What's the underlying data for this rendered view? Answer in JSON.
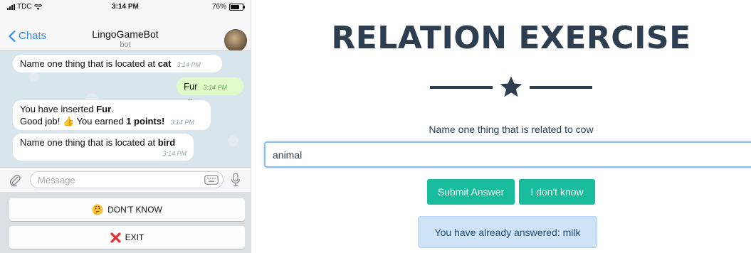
{
  "phone": {
    "status_bar": {
      "carrier": "TDC",
      "time": "3:14 PM",
      "battery_text": "76%",
      "battery_level": 0.76
    },
    "nav": {
      "back_label": "Chats",
      "title": "LingoGameBot",
      "subtitle": "bot"
    },
    "messages": [
      {
        "direction": "in",
        "text": "Name one thing that is located at ",
        "bold": "cat",
        "time": "3:14 PM"
      },
      {
        "direction": "out",
        "text": "Fur",
        "time": "3:14 PM"
      },
      {
        "direction": "in",
        "line1_text": "You have inserted ",
        "line1_bold": "Fur",
        "line1_end": ".",
        "line2_text": "Good job! ",
        "line2_mid": " You earned ",
        "line2_bold": "1 points!",
        "time": "3:14 PM"
      },
      {
        "direction": "in",
        "text": "Name one thing that is located at ",
        "bold": "bird",
        "time": "3:14 PM"
      }
    ],
    "input": {
      "placeholder": "Message"
    },
    "keyboard_buttons": [
      {
        "label": "DON'T KNOW",
        "icon": "thinking-face-icon"
      },
      {
        "label": "EXIT",
        "icon": "red-x-icon"
      }
    ]
  },
  "web": {
    "title": "RELATION EXERCISE",
    "question": "Name one thing that is related to cow",
    "answer_value": "animal",
    "buttons": {
      "submit": "Submit Answer",
      "dont_know": "I don't know"
    },
    "alert": "You have already answered: milk"
  },
  "colors": {
    "telegram_blue": "#2f8ef4",
    "chat_wallpaper": "#d9e5ec",
    "outgoing_bubble": "#e0fbc8",
    "web_heading": "#2c3e50",
    "web_button": "#18bc9c",
    "web_alert_bg": "#cfe3f7"
  }
}
